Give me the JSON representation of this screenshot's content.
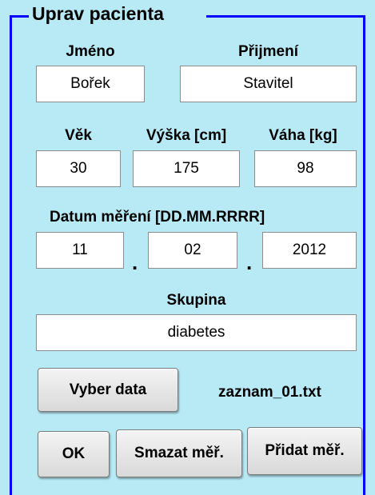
{
  "group": {
    "title": "Uprav pacienta"
  },
  "name_row": {
    "first_name_label": "Jméno",
    "last_name_label": "Přijmení",
    "first_name_value": "Bořek",
    "last_name_value": "Stavitel"
  },
  "metrics_row": {
    "age_label": "Věk",
    "height_label": "Výška [cm]",
    "weight_label": "Váha [kg]",
    "age_value": "30",
    "height_value": "175",
    "weight_value": "98"
  },
  "date": {
    "label": "Datum měření [DD.MM.RRRR]",
    "day": "11",
    "month": "02",
    "year": "2012",
    "separator": "."
  },
  "group_field": {
    "label": "Skupina",
    "value": "diabetes"
  },
  "data_select": {
    "button_label": "Vyber data",
    "file_name": "zaznam_01.txt"
  },
  "actions": {
    "ok_label": "OK",
    "delete_label": "Smazat měř.",
    "add_label": "Přidat měř."
  },
  "colors": {
    "panel_background": "#b8eaf6",
    "border": "#0000ff"
  }
}
